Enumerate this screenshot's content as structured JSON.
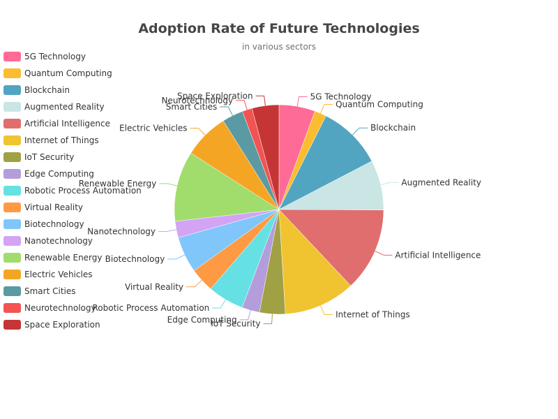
{
  "chart_data": {
    "type": "pie",
    "title": "Adoption Rate of Future Technologies",
    "subtitle": "in various sectors",
    "legend_position": "left",
    "slices": [
      {
        "name": "5G Technology",
        "value": 5.5,
        "color": "#ff6b97"
      },
      {
        "name": "Quantum Computing",
        "value": 1.8,
        "color": "#fbbd2f"
      },
      {
        "name": "Blockchain",
        "value": 9.8,
        "color": "#52a5c1"
      },
      {
        "name": "Augmented Reality",
        "value": 7.6,
        "color": "#c9e5e4"
      },
      {
        "name": "Artificial Intelligence",
        "value": 12.7,
        "color": "#e06e6e"
      },
      {
        "name": "Internet of Things",
        "value": 10.9,
        "color": "#f0c431"
      },
      {
        "name": "IoT Security",
        "value": 3.9,
        "color": "#a0a044"
      },
      {
        "name": "Edge Computing",
        "value": 2.7,
        "color": "#b39ddb"
      },
      {
        "name": "Robotic Process Automation",
        "value": 5.5,
        "color": "#65e1e3"
      },
      {
        "name": "Virtual Reality",
        "value": 3.7,
        "color": "#ff9a44"
      },
      {
        "name": "Biotechnology",
        "value": 5.5,
        "color": "#80c6fa"
      },
      {
        "name": "Nanotechnology",
        "value": 2.5,
        "color": "#d3a4f4"
      },
      {
        "name": "Renewable Energy",
        "value": 10.7,
        "color": "#a0dd6c"
      },
      {
        "name": "Electric Vehicles",
        "value": 6.9,
        "color": "#f5a524"
      },
      {
        "name": "Smart Cities",
        "value": 3.2,
        "color": "#5b9aa2"
      },
      {
        "name": "Neurotechnology",
        "value": 1.5,
        "color": "#f25353"
      },
      {
        "name": "Space Exploration",
        "value": 4.1,
        "color": "#c63535"
      }
    ]
  }
}
